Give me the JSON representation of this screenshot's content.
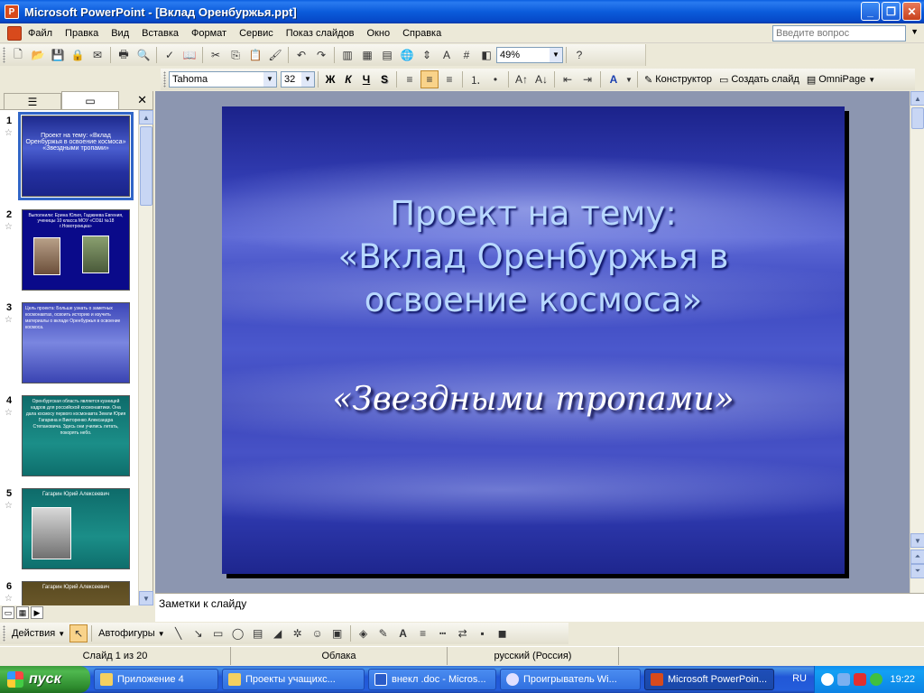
{
  "window": {
    "title": "Microsoft PowerPoint - [Вклад Оренбуржья.ppt]"
  },
  "menu": {
    "items": [
      "Файл",
      "Правка",
      "Вид",
      "Вставка",
      "Формат",
      "Сервис",
      "Показ слайдов",
      "Окно",
      "Справка"
    ],
    "help_placeholder": "Введите вопрос"
  },
  "toolbar": {
    "zoom": "49%"
  },
  "formatting": {
    "font": "Tahoma",
    "size": "32",
    "bold": "Ж",
    "italic": "К",
    "underline": "Ч",
    "shadow": "S",
    "designer": "Конструктор",
    "new_slide": "Создать слайд",
    "omnipage": "OmniPage"
  },
  "slides": [
    {
      "num": "1",
      "text": "Проект на тему: «Вклад Оренбуржья в освоение космоса» «Звездными тропами»"
    },
    {
      "num": "2",
      "text": "Выполнили: Ерина Юлия, Гаджиева Евгения, ученицы 10 класса МОУ «СОШ №18 г.Новотроицка»"
    },
    {
      "num": "3",
      "text": "Цель проекта: Больше узнать о заметных космонавтах, освоить историю и изучить материалы о вкладе Оренбуржья в освоение космоса."
    },
    {
      "num": "4",
      "text": "Оренбургская область является кузницей кадров для российской космонавтики. Она дала космосу первого космонавта Земли Юрия Гагарина и Викторенко Александра Степановича. Здесь они учились летать, покорять небо."
    },
    {
      "num": "5",
      "text": "Гагарин Юрий Алексеевич"
    },
    {
      "num": "6",
      "text": "Гагарин Юрий Алексеевич"
    }
  ],
  "main_slide": {
    "title_line1": "Проект на тему:",
    "title_line2": "«Вклад Оренбуржья в",
    "title_line3": "освоение космоса»",
    "subtitle": "«Звездными тропами»"
  },
  "notes": {
    "label": "Заметки к слайду"
  },
  "drawing": {
    "actions": "Действия",
    "autoshapes": "Автофигуры"
  },
  "status": {
    "slide": "Слайд 1 из 20",
    "design": "Облака",
    "language": "русский (Россия)"
  },
  "taskbar": {
    "start": "пуск",
    "items": [
      "Приложение 4",
      "Проекты учащихс...",
      "внекл .doc - Micros...",
      "Проигрыватель Wi...",
      "Microsoft PowerPoin..."
    ],
    "lang": "RU",
    "clock": "19:22"
  }
}
